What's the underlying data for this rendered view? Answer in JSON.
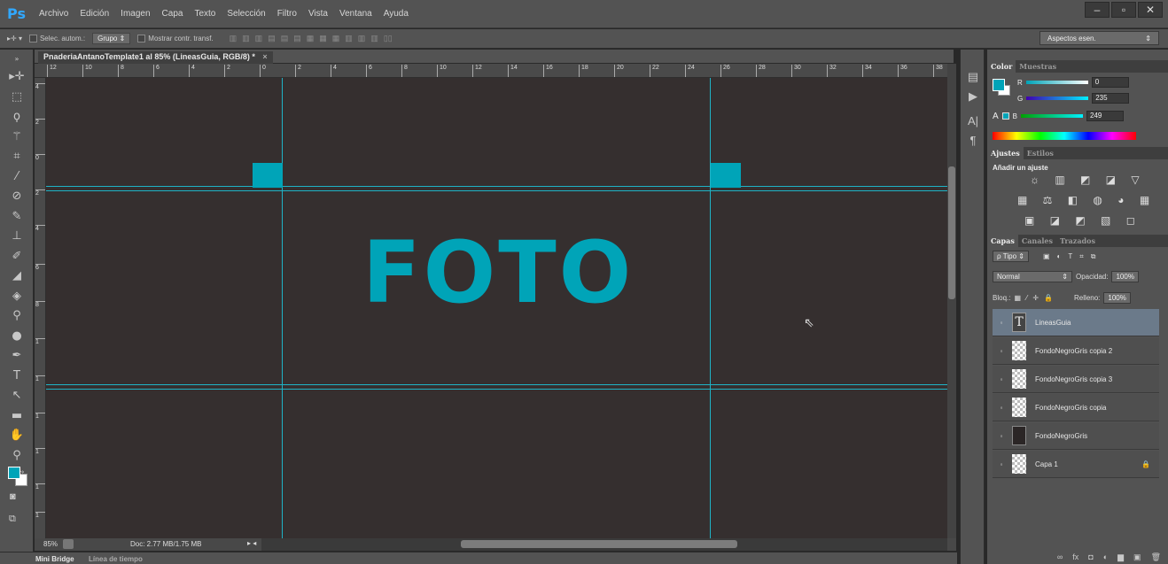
{
  "app": {
    "logo": "Ps"
  },
  "menu": [
    "Archivo",
    "Edición",
    "Imagen",
    "Capa",
    "Texto",
    "Selección",
    "Filtro",
    "Vista",
    "Ventana",
    "Ayuda"
  ],
  "window_buttons": [
    "–",
    "▫",
    "✕"
  ],
  "options": {
    "auto_select_label": "Selec. autom.:",
    "auto_select_value": "Grupo",
    "transform_label": "Mostrar contr. transf.",
    "workspace": "Aspectos esen."
  },
  "document": {
    "tab_title": "PnaderiaAntanoTemplate1 al 85% (LineasGuia, RGB/8) *",
    "close": "×",
    "canvas_text": "FOTO"
  },
  "rulers": {
    "top": [
      "12",
      "10",
      "8",
      "6",
      "4",
      "2",
      "0",
      "2",
      "4",
      "6",
      "8",
      "10",
      "12",
      "14",
      "16",
      "18",
      "20",
      "22",
      "24",
      "26",
      "28",
      "30",
      "32",
      "34",
      "36",
      "38"
    ],
    "left": [
      "4",
      "2",
      "0",
      "2",
      "4",
      "6",
      "8",
      "1",
      "1",
      "1",
      "1",
      "1",
      "1",
      "1"
    ]
  },
  "status": {
    "zoom": "85%",
    "doc": "Doc: 2.77 MB/1.75 MB"
  },
  "bottom_tabs": {
    "tab1": "Mini Bridge",
    "tab2": "Línea de tiempo"
  },
  "color_panel": {
    "tabs": [
      "Color",
      "Muestras"
    ],
    "channels": [
      {
        "label": "R",
        "value": "0"
      },
      {
        "label": "G",
        "value": "235"
      },
      {
        "label": "B",
        "value": "249"
      }
    ],
    "fg_color": "#00a4b8"
  },
  "adjust_panel": {
    "tabs": [
      "Ajustes",
      "Estilos"
    ],
    "title": "Añadir un ajuste",
    "icons_row1": "☼ ▥ ◩ ◪ ▽",
    "icons_row2": "▦ ⚖ ◧ ◍ ◕ ▦",
    "icons_row3": "▣ ◪ ◩ ▧ ◻"
  },
  "layers_panel": {
    "tabs": [
      "Capas",
      "Canales",
      "Trazados"
    ],
    "filter": "ρ Tipo",
    "blend_mode": "Normal",
    "opacity_label": "Opacidad:",
    "opacity": "100%",
    "lock_label": "Bloq.:",
    "fill_label": "Relleno:",
    "fill": "100%",
    "layers": [
      {
        "name": "LineasGuia",
        "thumb": "T"
      },
      {
        "name": "FondoNegroGris copia 2",
        "thumb": ""
      },
      {
        "name": "FondoNegroGris copia 3",
        "thumb": ""
      },
      {
        "name": "FondoNegroGris copia",
        "thumb": ""
      },
      {
        "name": "FondoNegroGris",
        "thumb": ""
      },
      {
        "name": "Capa 1",
        "thumb": ""
      }
    ]
  },
  "tool_icons": [
    "move-icon",
    "marquee-icon",
    "lasso-icon",
    "magic-wand-icon",
    "crop-icon",
    "eyedropper-icon",
    "healing-icon",
    "brush-icon",
    "stamp-icon",
    "history-brush-icon",
    "eraser-icon",
    "bucket-icon",
    "blur-icon",
    "dodge-icon",
    "pen-icon",
    "type-icon",
    "path-select-icon",
    "shape-icon",
    "hand-icon",
    "zoom-icon"
  ]
}
